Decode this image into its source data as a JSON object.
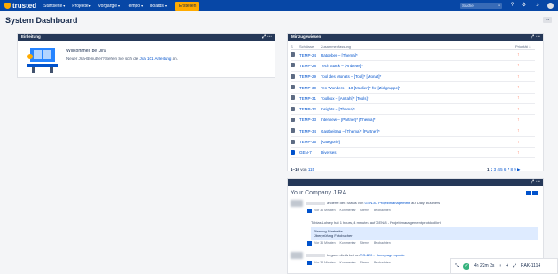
{
  "topbar": {
    "brand": "trusted",
    "nav": [
      "Startseite",
      "Projekte",
      "Vorgänge",
      "Tempo",
      "Boards"
    ],
    "create_label": "Erstellen",
    "search_placeholder": "Suche"
  },
  "page": {
    "title": "System Dashboard",
    "tools_label": "..."
  },
  "intro": {
    "header": "Einleitung",
    "welcome": "Willkommen bei Jira",
    "text_before": "Neuer Jira-Benutzer? Sehen Sie sich die ",
    "link": "Jira 101 Anleitung",
    "text_after": " an."
  },
  "assigned": {
    "header": "Mir zugewiesen",
    "columns": {
      "t": "S",
      "key": "Schlüssel",
      "summary": "Zusammenfassung",
      "priority": "Priorität ↓"
    },
    "rows": [
      {
        "key": "TEMP-24",
        "summary": "Ratgeber – [Thema]*",
        "done": false
      },
      {
        "key": "TEMP-28",
        "summary": "Tech Stack – [Anbieter]*",
        "done": false
      },
      {
        "key": "TEMP-29",
        "summary": "Tool des Monats – [Tool]* [Monat]*",
        "done": false
      },
      {
        "key": "TEMP-30",
        "summary": "Ten Wonders – 10 [Medien]* für [Zielgruppe]*",
        "done": false
      },
      {
        "key": "TEMP-31",
        "summary": "Toolbox – [Anzahl]* [Tools]*",
        "done": false
      },
      {
        "key": "TEMP-32",
        "summary": "Insights – [Thema]*",
        "done": false
      },
      {
        "key": "TEMP-33",
        "summary": "Interview – [Partner]* [Thema]*",
        "done": false
      },
      {
        "key": "TEMP-34",
        "summary": "Gastbeitrag – [Thema]* [Partner]*",
        "done": false
      },
      {
        "key": "TEMP-35",
        "summary": "[Kategorie]",
        "done": false
      },
      {
        "key": "GEN-7",
        "summary": "Diverses",
        "done": true
      }
    ],
    "pager_range": "1–10",
    "pager_of": "von",
    "pager_total": "115",
    "pages": [
      "1",
      "2",
      "3",
      "4",
      "5",
      "6",
      "7",
      "8",
      "9"
    ],
    "next": "▶"
  },
  "stream": {
    "title": "Your Company JIRA",
    "items": [
      {
        "text": "änderte den Status von ",
        "link": "GEN-8 - Projektmanagement",
        "tail": " auf Daily Business",
        "time": "Vor 36 Minuten"
      },
      {
        "text": "Tobias Lohrey hat 1 hours, 4 minutes auf GEN-8 - Projektmanagement protokolliert",
        "link": "",
        "tail": "",
        "time": "Vor 36 Minuten"
      },
      {
        "text": "begann die Arbeit an ",
        "link": "TG-220 - Homepage update",
        "tail": "",
        "time": "Vor 38 Minuten"
      }
    ],
    "quote_lines": [
      "Planung Startseite",
      "Überprüfung Fotobucher"
    ],
    "actions": [
      "Kommentar",
      "Sterne",
      "Beobachten"
    ]
  },
  "timer": {
    "elapsed": "4h 22m 3s",
    "issue": "RAK-1114"
  }
}
